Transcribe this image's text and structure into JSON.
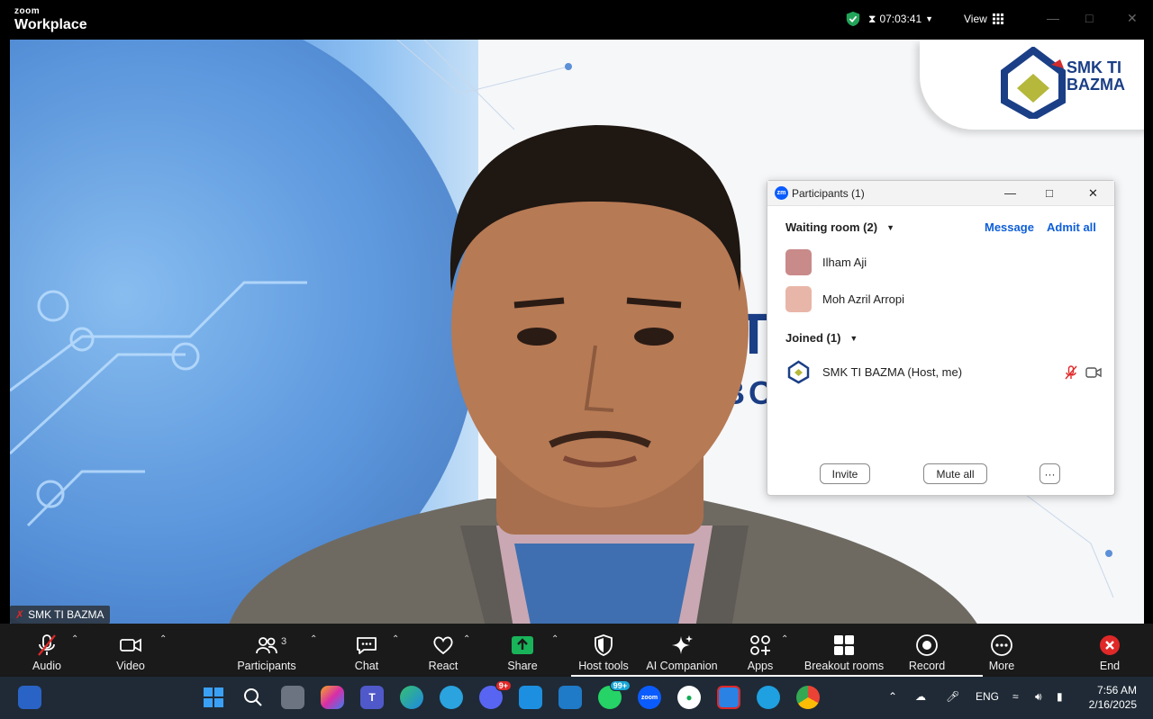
{
  "titlebar": {
    "brand_top": "zoom",
    "brand_bottom": "Workplace",
    "timer": "07:03:41",
    "view_label": "View"
  },
  "stage": {
    "logo_line1": "SMK TI",
    "logo_line2": "BAZMA",
    "backdrop_letter": "T",
    "backdrop_word": "BO",
    "name_tag": "SMK TI BAZMA"
  },
  "participants_panel": {
    "title": "Participants (1)",
    "waiting_header": "Waiting room (2)",
    "message_link": "Message",
    "admit_all_link": "Admit all",
    "waiting": [
      {
        "name": "Ilham Aji"
      },
      {
        "name": "Moh Azril Arropi"
      }
    ],
    "joined_header": "Joined (1)",
    "joined": [
      {
        "name": "SMK TI BAZMA (Host, me)"
      }
    ],
    "invite_label": "Invite",
    "mute_all_label": "Mute all",
    "more_label": "···"
  },
  "toolbar": {
    "audio": "Audio",
    "video": "Video",
    "participants": "Participants",
    "participants_count": "3",
    "chat": "Chat",
    "react": "React",
    "share": "Share",
    "host_tools": "Host tools",
    "ai_companion": "AI Companion",
    "apps": "Apps",
    "breakout_rooms": "Breakout rooms",
    "record": "Record",
    "more": "More",
    "end": "End"
  },
  "taskbar": {
    "whatsapp_badge": "99+",
    "discord_badge": "9+",
    "language": "ENG",
    "time": "7:56 AM",
    "date": "2/16/2025"
  },
  "colors": {
    "accent_green": "#22a35a",
    "link_blue": "#0e5fd8",
    "end_red": "#e02828",
    "share_green": "#19b35a"
  }
}
